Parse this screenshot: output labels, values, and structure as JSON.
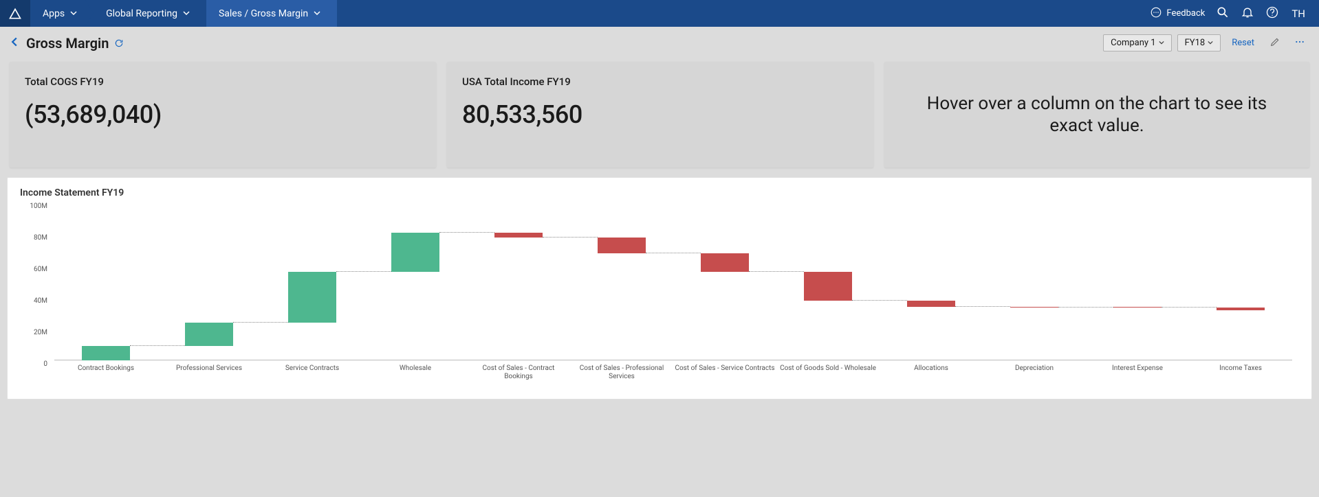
{
  "nav": {
    "apps": "Apps",
    "breadcrumb1": "Global Reporting",
    "breadcrumb2": "Sales / Gross Margin",
    "feedback": "Feedback",
    "user": "TH"
  },
  "header": {
    "title": "Gross Margin",
    "company_dropdown": "Company 1",
    "year_dropdown": "FY18",
    "reset": "Reset"
  },
  "kpi": [
    {
      "label": "Total COGS FY19",
      "value": "(53,689,040)"
    },
    {
      "label": "USA Total Income FY19",
      "value": "80,533,560"
    }
  ],
  "hint": "Hover over a column on the chart to see its exact value.",
  "chart_title": "Income Statement FY19",
  "chart_data": {
    "type": "waterfall",
    "title": "Income Statement FY19",
    "ylabel": "",
    "ylim": [
      0,
      100
    ],
    "y_unit": "M",
    "y_ticks": [
      0,
      20,
      40,
      60,
      80,
      100
    ],
    "categories": [
      "Contract Bookings",
      "Professional Services",
      "Service Contracts",
      "Wholesale",
      "Cost of Sales - Contract Bookings",
      "Cost of Sales - Professional Services",
      "Cost of Sales - Service Contracts",
      "Cost of Goods Sold - Wholesale",
      "Allocations",
      "Depreciation",
      "Interest Expense",
      "Income Taxes"
    ],
    "values": [
      9,
      15,
      32,
      25,
      -3,
      -10,
      -12,
      -18,
      -4,
      -0.5,
      -0.2,
      -1.5
    ],
    "colors": {
      "positive": "#4eb78f",
      "negative": "#c64d4d"
    }
  }
}
